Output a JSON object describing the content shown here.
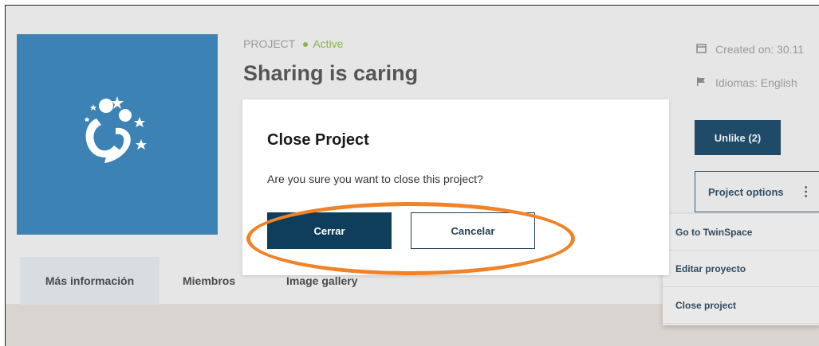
{
  "project": {
    "type_label": "PROJECT",
    "status": "Active",
    "title": "Sharing is caring"
  },
  "side_info": {
    "created": "Created on: 30.11",
    "languages": "Idiomas: English"
  },
  "actions": {
    "unlike_label": "Unlike (2)",
    "options_label": "Project options",
    "options_kebab": "⋮"
  },
  "dropdown": {
    "items": [
      {
        "label": "Go to TwinSpace"
      },
      {
        "label": "Editar proyecto"
      },
      {
        "label": "Close project"
      }
    ]
  },
  "tabs": [
    {
      "label": "Más información",
      "active": true
    },
    {
      "label": "Miembros",
      "active": false
    },
    {
      "label": "Image gallery",
      "active": false
    }
  ],
  "modal": {
    "title": "Close Project",
    "message": "Are you sure you want to close this project?",
    "confirm_label": "Cerrar",
    "cancel_label": "Cancelar"
  },
  "icons": {
    "calendar": "calendar-icon",
    "flag": "flag-icon",
    "logo": "project-logo-icon"
  },
  "colors": {
    "logo_bg": "#3d82b5",
    "primary_button": "#0e3e5c",
    "status_green": "#8bb54a",
    "highlight_ring": "#f08228"
  }
}
